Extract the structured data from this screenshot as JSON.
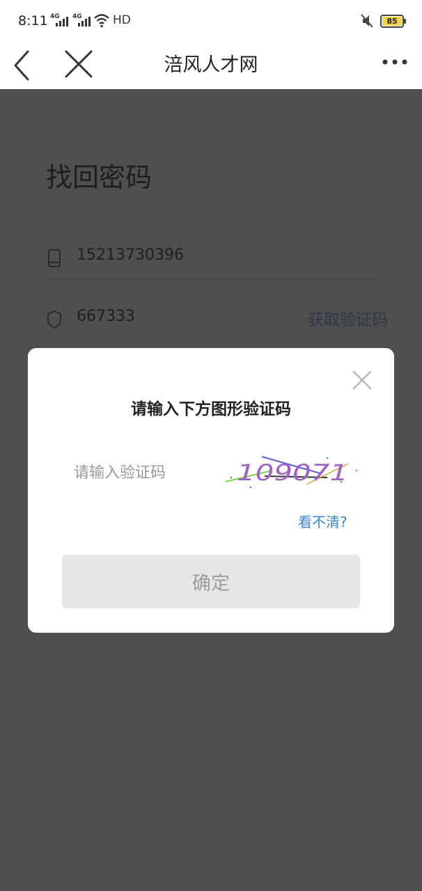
{
  "status_bar": {
    "time": "8:11",
    "signal_1": "4G",
    "signal_2": "4G",
    "hd": "HD",
    "battery": "85",
    "icons": [
      "signal-icon",
      "wifi-icon",
      "mute-icon",
      "battery-icon"
    ]
  },
  "nav": {
    "title": "涪风人才网",
    "icons": [
      "back-icon",
      "close-icon",
      "more-icon"
    ]
  },
  "page": {
    "title": "找回密码",
    "phone_value": "15213730396",
    "code_value": "667333",
    "get_code_label": "获取验证码"
  },
  "dialog": {
    "title": "请输入下方图形验证码",
    "input_placeholder": "请输入验证码",
    "captcha_text": "109071",
    "refresh_label": "看不清?",
    "confirm_label": "确定"
  },
  "colors": {
    "overlay": "#4f4f4f",
    "link": "#3c86d8",
    "button_disabled_bg": "#e6e6e6",
    "button_disabled_text": "#9d9d9d",
    "battery_fill": "#f4d34a"
  }
}
